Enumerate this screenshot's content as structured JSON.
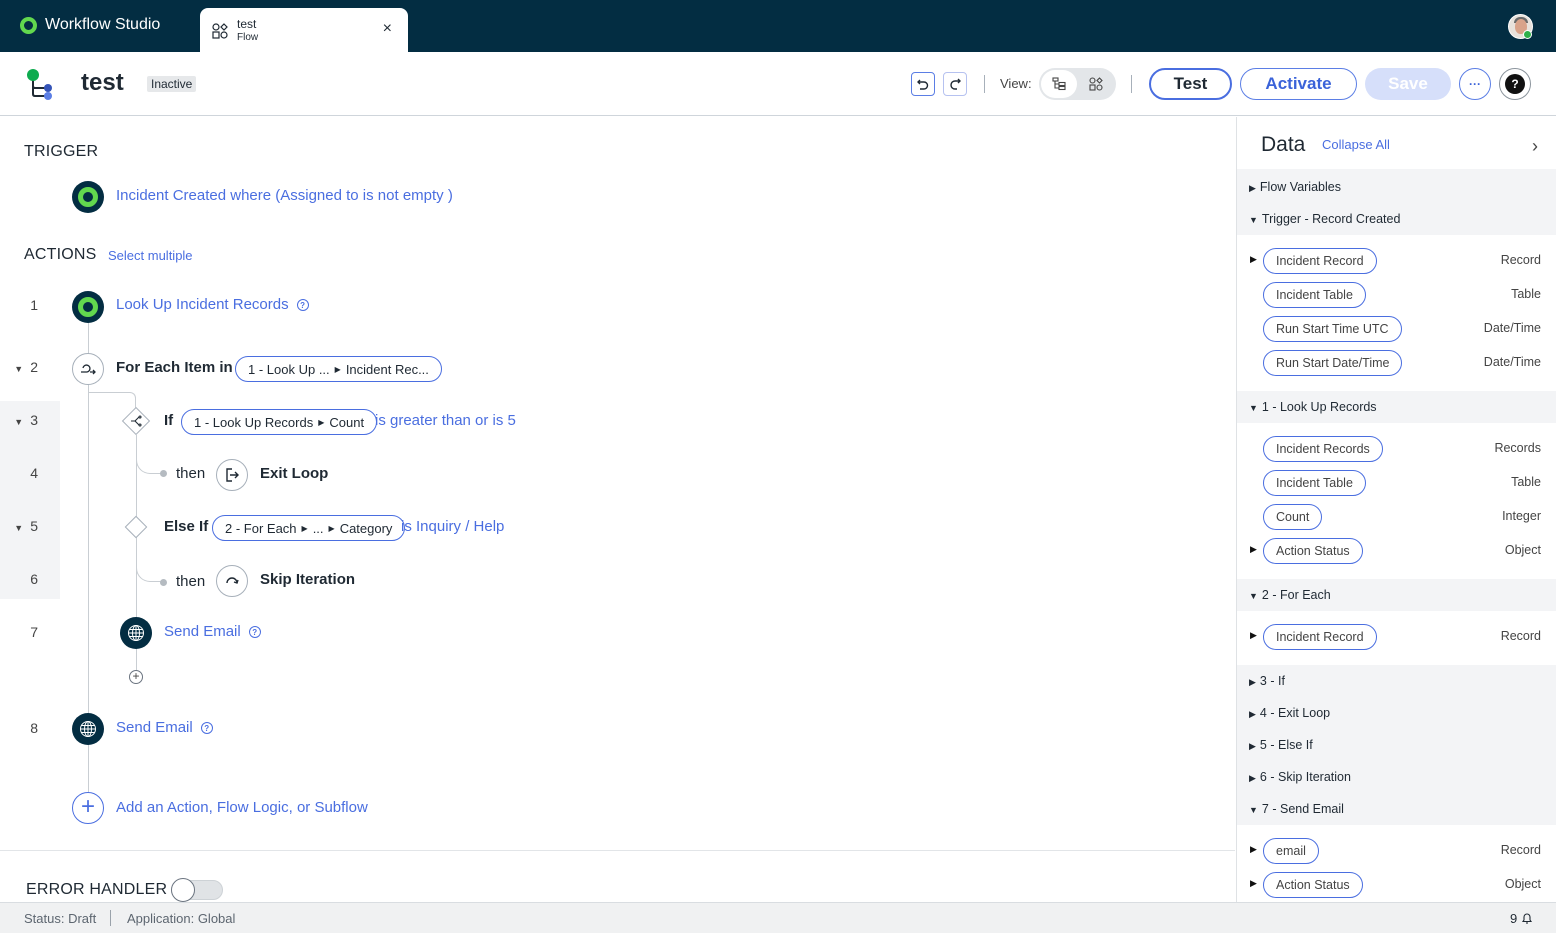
{
  "app": {
    "title": "Workflow Studio"
  },
  "tab": {
    "title": "test",
    "subtitle": "Flow",
    "close_icon": "×"
  },
  "header": {
    "title": "test",
    "status_badge": "Inactive",
    "view_label": "View:",
    "buttons": {
      "test": "Test",
      "activate": "Activate",
      "save": "Save",
      "more": "···",
      "help": "?"
    }
  },
  "trigger": {
    "section_label": "TRIGGER",
    "text": "Incident Created where (Assigned to is not empty )"
  },
  "actions": {
    "section_label": "ACTIONS",
    "select_multiple": "Select multiple",
    "rows": [
      {
        "num": "1",
        "label": "Look Up Incident Records"
      },
      {
        "num": "2",
        "label": "For Each Item in",
        "pill_parts": [
          "1 - Look Up ...",
          "Incident Rec..."
        ]
      },
      {
        "num": "3",
        "label": "If",
        "pill_parts": [
          "1 - Look Up Records",
          "Count"
        ],
        "condition": "is greater than or is 5"
      },
      {
        "num": "4",
        "then": "then",
        "label": "Exit Loop"
      },
      {
        "num": "5",
        "label": "Else If",
        "pill_parts": [
          "2 - For Each",
          "...",
          "Category"
        ],
        "condition": "is Inquiry / Help"
      },
      {
        "num": "6",
        "then": "then",
        "label": "Skip Iteration"
      },
      {
        "num": "7",
        "label": "Send Email"
      },
      {
        "num": "8",
        "label": "Send Email"
      }
    ],
    "add_label": "Add an Action, Flow Logic, or Subflow"
  },
  "error_handler": {
    "label": "ERROR HANDLER",
    "enabled": false
  },
  "statusbar": {
    "status": "Status: Draft",
    "application": "Application: Global",
    "notifications": "9"
  },
  "data_panel": {
    "title": "Data",
    "collapse_all": "Collapse All",
    "groups": [
      {
        "label": "Flow Variables",
        "expanded": false
      },
      {
        "label": "Trigger - Record Created",
        "expanded": true,
        "items": [
          {
            "name": "Incident Record",
            "type": "Record",
            "expandable": true
          },
          {
            "name": "Incident Table",
            "type": "Table",
            "expandable": false
          },
          {
            "name": "Run Start Time UTC",
            "type": "Date/Time",
            "expandable": false
          },
          {
            "name": "Run Start Date/Time",
            "type": "Date/Time",
            "expandable": false
          }
        ]
      },
      {
        "label": "1 - Look Up Records",
        "expanded": true,
        "items": [
          {
            "name": "Incident Records",
            "type": "Records",
            "expandable": false
          },
          {
            "name": "Incident Table",
            "type": "Table",
            "expandable": false
          },
          {
            "name": "Count",
            "type": "Integer",
            "expandable": false
          },
          {
            "name": "Action Status",
            "type": "Object",
            "expandable": true
          }
        ]
      },
      {
        "label": "2 - For Each",
        "expanded": true,
        "items": [
          {
            "name": "Incident Record",
            "type": "Record",
            "expandable": true
          }
        ]
      },
      {
        "label": "3 - If",
        "expanded": false
      },
      {
        "label": "4 - Exit Loop",
        "expanded": false
      },
      {
        "label": "5 - Else If",
        "expanded": false
      },
      {
        "label": "6 - Skip Iteration",
        "expanded": false
      },
      {
        "label": "7 - Send Email",
        "expanded": true,
        "items": [
          {
            "name": "email",
            "type": "Record",
            "expandable": true
          },
          {
            "name": "Action Status",
            "type": "Object",
            "expandable": true
          }
        ]
      }
    ]
  },
  "colors": {
    "topbar": "#032d42",
    "accent": "#4a6ee0",
    "brand_green": "#62d84e"
  }
}
